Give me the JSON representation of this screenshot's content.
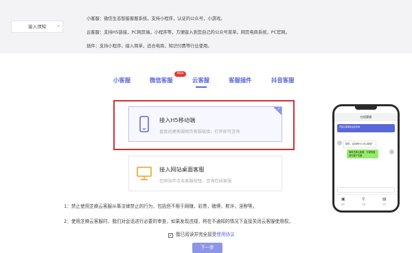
{
  "header": {
    "tag_label": "接入须知",
    "info_lines": [
      "小客服：微信生态智能客服系统，支持小程序，认证的公众号，小游戏。",
      "云客服：支持H5链接，PC网页端，小程序等，方便嵌入到您自己的公众号菜单，网页电商系统，PC官网。",
      "插件：支持小程序，接入简单，适合电商，知识付费等行业使用。"
    ]
  },
  "tabs": [
    {
      "label": "小客服"
    },
    {
      "label": "微信客服"
    },
    {
      "label": "云客服",
      "active": true
    },
    {
      "label": "客服插件"
    },
    {
      "label": "抖音客服"
    }
  ],
  "new_badge": "New",
  "cards": [
    {
      "title": "接入H5移动端",
      "subtitle": "直接创建客服网页客服链接，打开即可咨询",
      "icon": "mobile-phone-icon",
      "selected": true
    },
    {
      "title": "接入网站桌面客服",
      "subtitle": "在网站中点击客服按钮，咨询在线客服",
      "icon": "desktop-monitor-icon",
      "selected": false
    }
  ],
  "notes": [
    "1：禁止使用芝麻云客服从事法律禁止的行为，包括但不限于网赚，彩票，赌博，欺诈，淫秽等。",
    "2：使用芝麻云客服时，我们对会话进行必要的审查，如果发现违规，将在不通知的情况下直接关闭云客服使用权。"
  ],
  "agreement": {
    "text": "我已阅读并完全接受",
    "link": "使用协议",
    "checked": true
  },
  "next_button": "下一步",
  "phone_preview": {
    "title": "在线客服",
    "banner_text": "芝麻云客服欢迎您咨询",
    "messages": [
      "您好，请问有什么可以帮您？",
      "使用芝麻云客服，方便快捷地与客户沟通"
    ],
    "tools": [
      "图片",
      "位置",
      "文件"
    ]
  },
  "colors": {
    "accent": "#5a67d8",
    "highlight_frame": "#d32f2f",
    "badge": "#e53935"
  }
}
